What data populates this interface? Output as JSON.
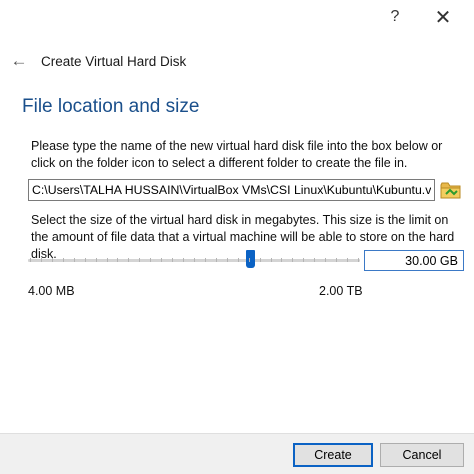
{
  "window": {
    "help_glyph": "?",
    "close_glyph": "✕"
  },
  "header": {
    "back_glyph": "←",
    "title": "Create Virtual Hard Disk"
  },
  "section": {
    "title": "File location and size"
  },
  "location": {
    "description": "Please type the name of the new virtual hard disk file into the box below or click on the folder icon to select a different folder to create the file in.",
    "path_value": "C:\\Users\\TALHA HUSSAIN\\VirtualBox VMs\\CSI Linux\\Kubuntu\\Kubuntu.vdi",
    "folder_icon": "folder-icon"
  },
  "size": {
    "description": "Select the size of the virtual hard disk in megabytes. This size is the limit on the amount of file data that a virtual machine will be able to store on the hard disk.",
    "value": "30.00 GB",
    "min_label": "4.00 MB",
    "max_label": "2.00 TB",
    "slider_fraction": 0.67
  },
  "buttons": {
    "create": "Create",
    "cancel": "Cancel"
  },
  "colors": {
    "accent": "#0b62c4",
    "section_title": "#1a4f8b",
    "footer_bg": "#f0f0f0"
  }
}
